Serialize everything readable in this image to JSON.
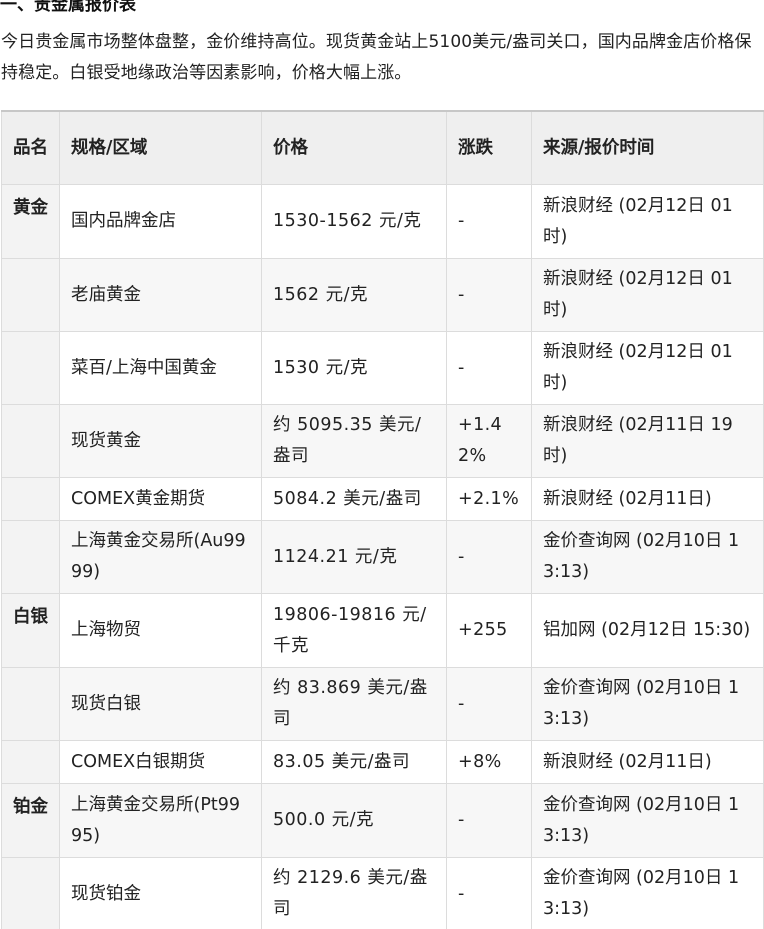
{
  "section": {
    "title": "一、贵金属报价表",
    "intro": "今日贵金属市场整体盘整，金价维持高位。现货黄金站上5100美元/盎司关口，国内品牌金店价格保持稳定。白银受地缘政治等因素影响，价格大幅上涨。"
  },
  "table": {
    "headers": {
      "category": "品名",
      "spec": "规格/区域",
      "price": "价格",
      "change": "涨跌",
      "source": "来源/报价时间"
    },
    "rows": [
      {
        "category": "黄金",
        "spec": "国内品牌金店",
        "price": "1530-1562 元/克",
        "change": "-",
        "source": "新浪财经 (02月12日 01时)"
      },
      {
        "category": "",
        "spec": "老庙黄金",
        "price": "1562 元/克",
        "change": "-",
        "source": "新浪财经 (02月12日 01时)"
      },
      {
        "category": "",
        "spec": "菜百/上海中国黄金",
        "price": "1530 元/克",
        "change": "-",
        "source": "新浪财经 (02月12日 01时)"
      },
      {
        "category": "",
        "spec": "现货黄金",
        "price": "约 5095.35 美元/盎司",
        "change": "+1.42%",
        "source": "新浪财经 (02月11日 19时)"
      },
      {
        "category": "",
        "spec": "COMEX黄金期货",
        "price": "5084.2 美元/盎司",
        "change": "+2.1%",
        "source": "新浪财经 (02月11日)"
      },
      {
        "category": "",
        "spec": "上海黄金交易所(Au9999)",
        "price": "1124.21 元/克",
        "change": "-",
        "source": "金价查询网 (02月10日 13:13)"
      },
      {
        "category": "白银",
        "spec": "上海物贸",
        "price": "19806-19816 元/千克",
        "change": "+255",
        "source": "铝加网 (02月12日 15:30)"
      },
      {
        "category": "",
        "spec": "现货白银",
        "price": "约 83.869 美元/盎司",
        "change": "-",
        "source": "金价查询网 (02月10日 13:13)"
      },
      {
        "category": "",
        "spec": "COMEX白银期货",
        "price": "83.05 美元/盎司",
        "change": "+8%",
        "source": "新浪财经 (02月11日)"
      },
      {
        "category": "铂金",
        "spec": "上海黄金交易所(Pt9995)",
        "price": "500.0 元/克",
        "change": "-",
        "source": "金价查询网 (02月10日 13:13)"
      },
      {
        "category": "",
        "spec": "现货铂金",
        "price": "约 2129.6 美元/盎司",
        "change": "-",
        "source": "金价查询网 (02月10日 13:13)"
      }
    ]
  }
}
